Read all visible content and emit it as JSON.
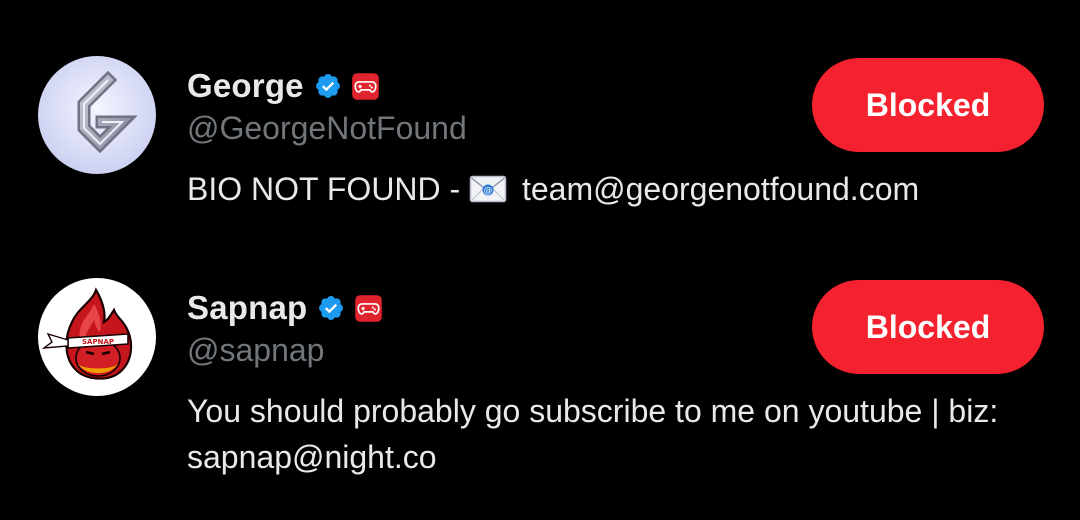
{
  "colors": {
    "background": "#000000",
    "primary_text": "#e7e9ea",
    "secondary_text": "#71767b",
    "blocked_button": "#f4212e",
    "verified_badge": "#1d9bf0"
  },
  "users": [
    {
      "name": "George",
      "handle": "@GeorgeNotFound",
      "bio_prefix": "BIO NOT FOUND - ",
      "bio_suffix": " team@georgenotfound.com",
      "button_label": "Blocked",
      "verified": true,
      "badge_icon": "gamepad-icon"
    },
    {
      "name": "Sapnap",
      "handle": "@sapnap",
      "bio": "You should probably go subscribe to me on youtube | biz: sapnap@night.co",
      "button_label": "Blocked",
      "verified": true,
      "badge_icon": "gamepad-icon"
    }
  ]
}
